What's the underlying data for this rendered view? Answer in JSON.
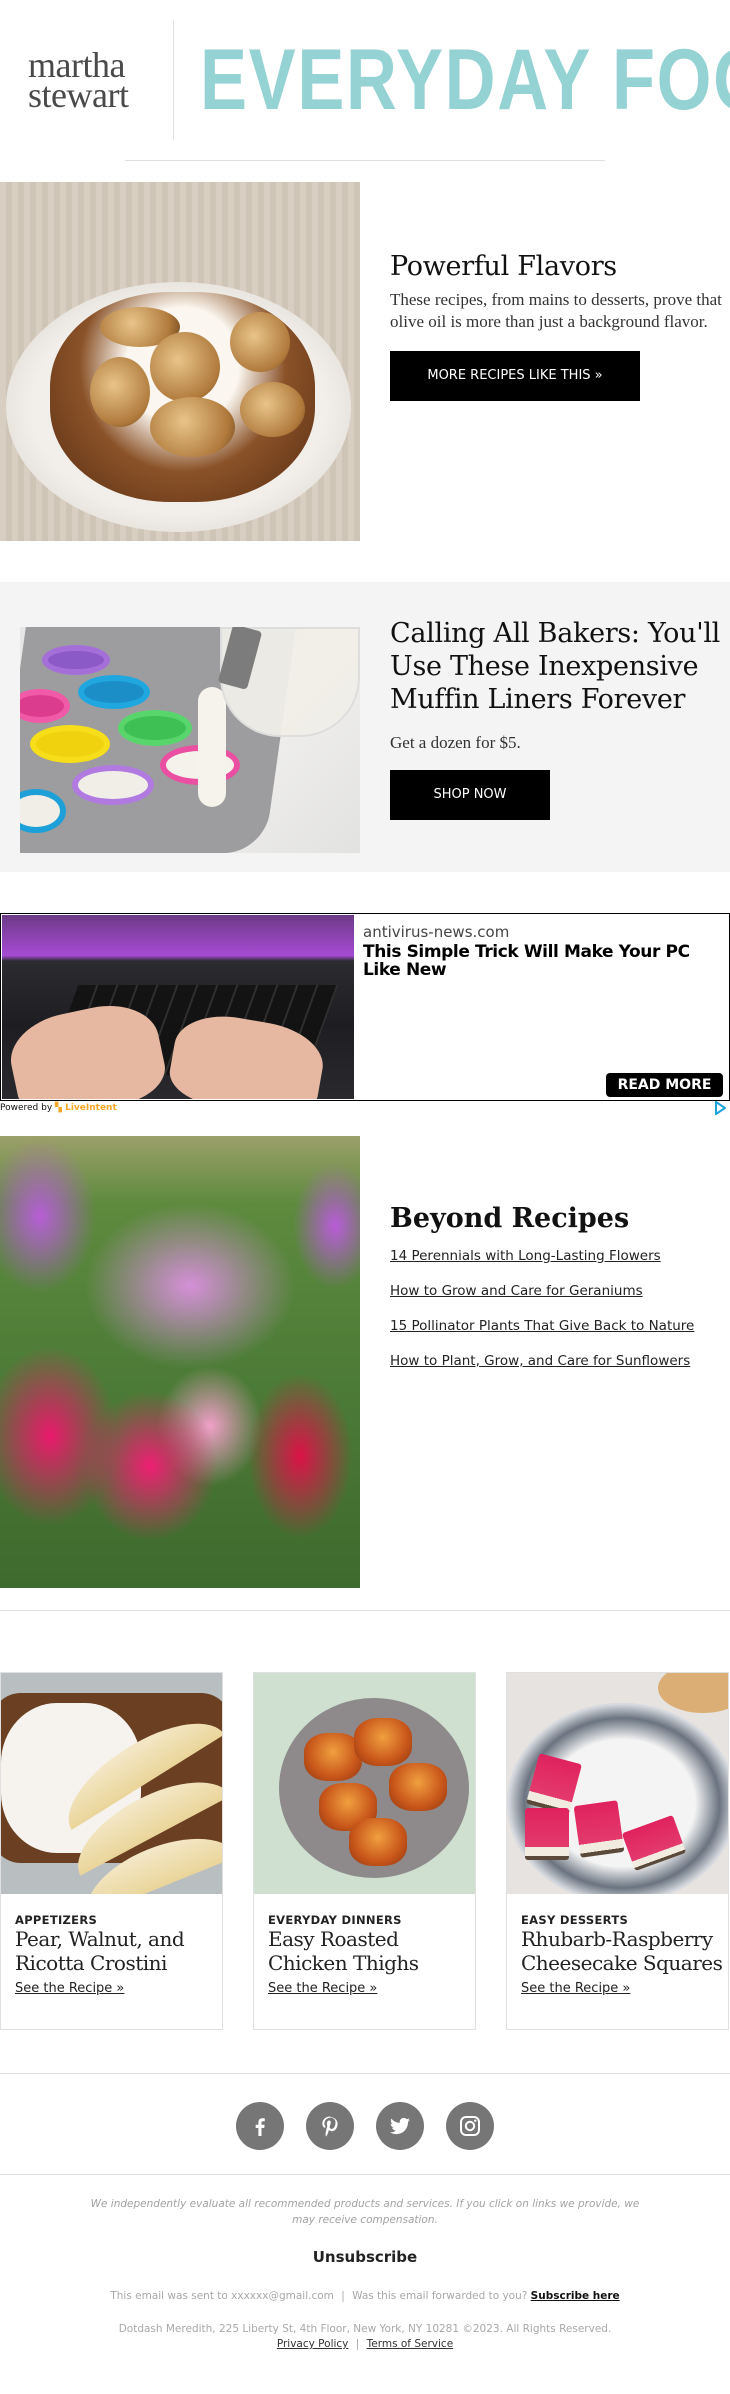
{
  "header": {
    "brand_line1": "martha",
    "brand_line2": "stewart",
    "publication": "EVERYDAY FOOD",
    "accent_color": "#95d2d4"
  },
  "features": [
    {
      "title": "Powerful Flavors",
      "description": "These recipes, from mains to desserts, prove that olive oil is more than just a background flavor.",
      "button_label": "MORE RECIPES LIKE THIS »",
      "image_alt": "Pear-topped cake with caramel sauce on a white plate"
    },
    {
      "title": "Calling All Bakers: You'll Use These Inexpensive Muffin Liners Forever",
      "description": "Get a dozen for $5.",
      "button_label": "SHOP NOW",
      "image_alt": "Batter poured into colorful silicone muffin liners"
    }
  ],
  "ad": {
    "domain": "antivirus-news.com",
    "headline": "This Simple Trick Will Make Your PC Like New",
    "cta_label": "READ MORE",
    "powered_by_label": "Powered by",
    "powered_by_brand": "LiveIntent",
    "image_alt": "Hands typing on a laptop keyboard"
  },
  "beyond": {
    "title": "Beyond Recipes",
    "links": [
      "14 Perennials with Long-Lasting Flowers",
      "How to Grow and Care for Geraniums",
      "15 Pollinator Plants That Give Back to Nature",
      "How to Plant, Grow, and Care for Sunflowers"
    ],
    "image_alt": "Garden bed of pink, purple, and red astilbe flowers"
  },
  "cards": [
    {
      "category": "APPETIZERS",
      "title": "Pear, Walnut, and Ricotta Crostini",
      "link_label": "See the Recipe »"
    },
    {
      "category": "EVERYDAY DINNERS",
      "title": "Easy Roasted Chicken Thighs",
      "link_label": "See the Recipe »"
    },
    {
      "category": "EASY DESSERTS",
      "title": "Rhubarb-Raspberry Cheesecake Squares",
      "link_label": "See the Recipe »"
    }
  ],
  "social": [
    {
      "name": "facebook",
      "icon": "facebook-icon"
    },
    {
      "name": "pinterest",
      "icon": "pinterest-icon"
    },
    {
      "name": "twitter",
      "icon": "twitter-icon"
    },
    {
      "name": "instagram",
      "icon": "instagram-icon"
    }
  ],
  "footer": {
    "disclaimer": "We independently evaluate all recommended products and services. If you click on links we provide, we may receive compensation.",
    "unsubscribe_label": "Unsubscribe",
    "sent_to_text": "This email was sent to xxxxxx@gmail.com",
    "separator": "|",
    "forwarded_text": "Was this email forwarded to you?",
    "subscribe_label": "Subscribe here",
    "address": "Dotdash Meredith, 225 Liberty St, 4th Floor, New York, NY 10281 ©2023. All Rights Reserved.",
    "privacy_label": "Privacy Policy",
    "terms_label": "Terms of Service"
  }
}
